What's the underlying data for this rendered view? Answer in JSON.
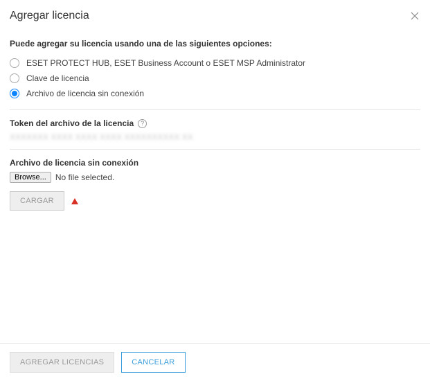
{
  "header": {
    "title": "Agregar licencia"
  },
  "intro": "Puede agregar su licencia usando una de las siguientes opciones:",
  "radios": {
    "opt1": "ESET PROTECT HUB, ESET Business Account o ESET MSP Administrator",
    "opt2": "Clave de licencia",
    "opt3": "Archivo de licencia sin conexión"
  },
  "token": {
    "label": "Token del archivo de la licencia",
    "value": "XXXXXXX XXXX XXXX XXXX XXXXXXXXXX XX"
  },
  "file": {
    "label": "Archivo de licencia sin conexión",
    "browse": "Browse...",
    "nofile": "No file selected.",
    "upload": "CARGAR"
  },
  "footer": {
    "add": "AGREGAR LICENCIAS",
    "cancel": "CANCELAR"
  }
}
